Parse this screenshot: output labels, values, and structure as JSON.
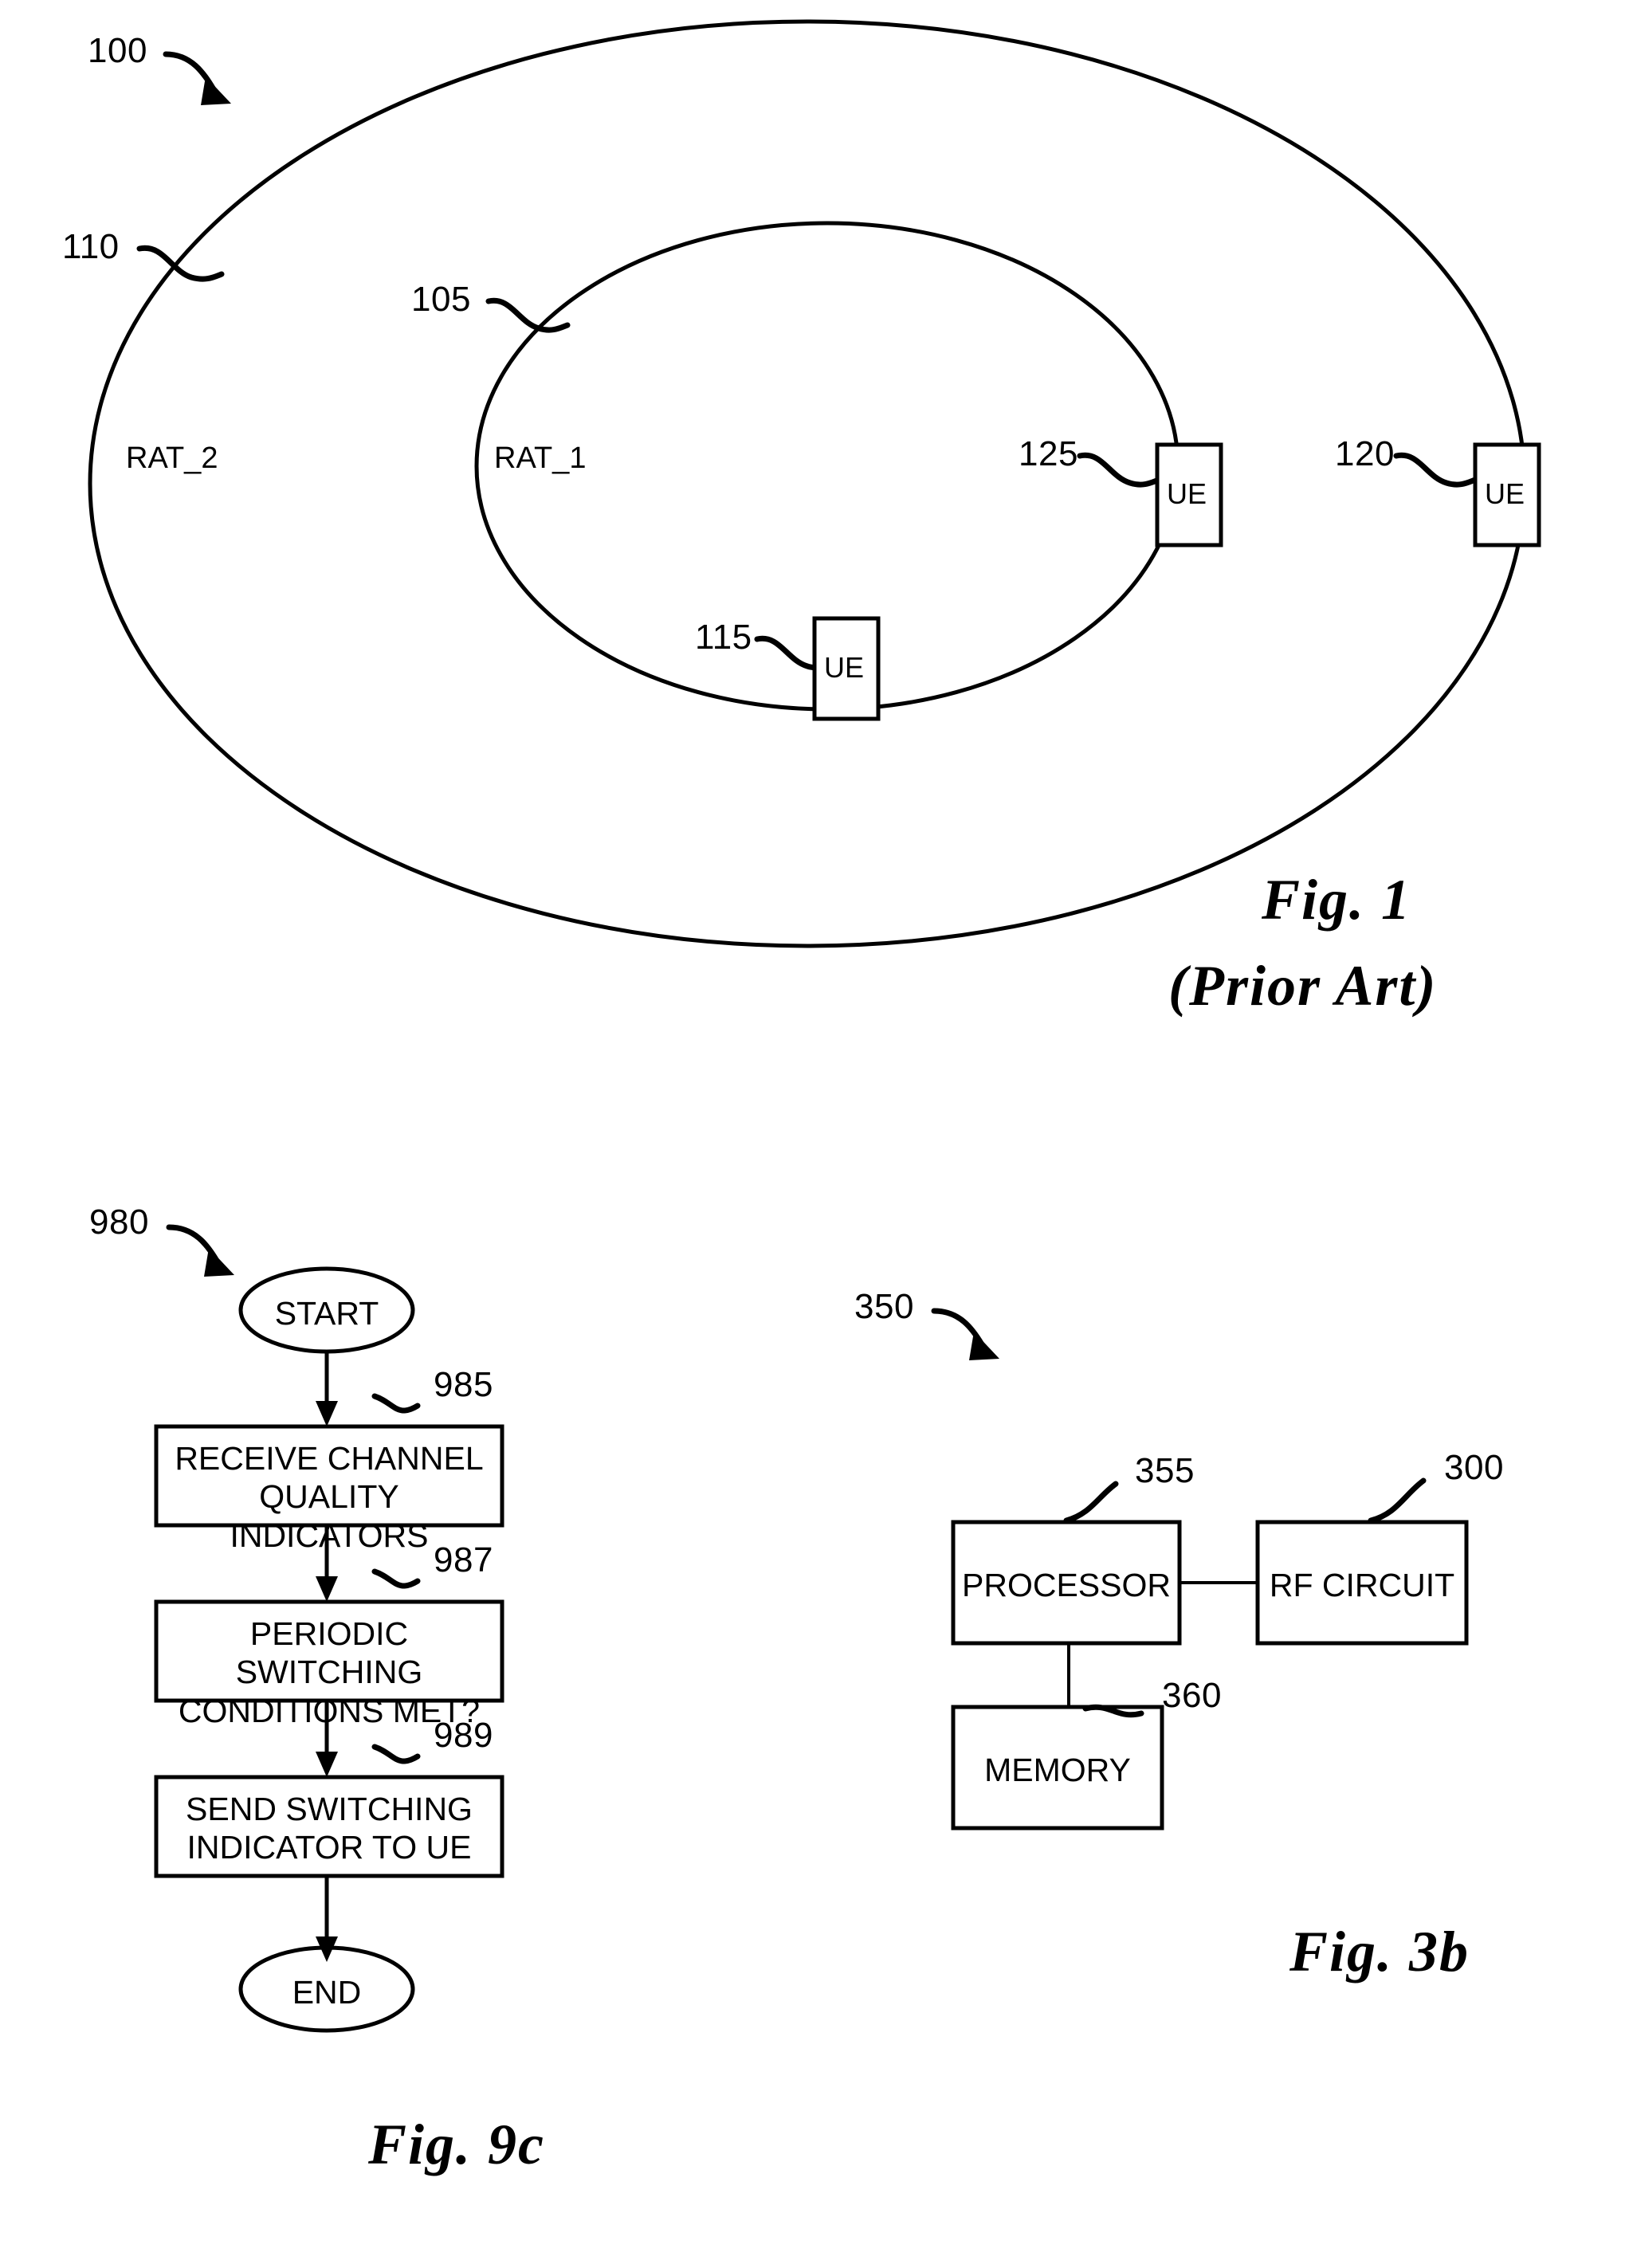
{
  "figure1": {
    "caption_line1": "Fig. 1",
    "caption_line2": "(Prior Art)",
    "ref_system": "100",
    "ref_outer_cell": "110",
    "ref_inner_cell": "105",
    "outer_cell_label": "RAT_2",
    "inner_cell_label": "RAT_1",
    "ue_inner": {
      "ref": "115",
      "label": "UE"
    },
    "ue_boundary": {
      "ref": "125",
      "label": "UE"
    },
    "ue_outer": {
      "ref": "120",
      "label": "UE"
    }
  },
  "figure9c": {
    "caption": "Fig. 9c",
    "ref_flow": "980",
    "nodes": [
      {
        "ref": "",
        "label": "START",
        "shape": "terminal"
      },
      {
        "ref": "985",
        "label": "RECEIVE CHANNEL\nQUALITY INDICATORS",
        "shape": "process"
      },
      {
        "ref": "987",
        "label": "PERIODIC SWITCHING\nCONDITIONS MET?",
        "shape": "process"
      },
      {
        "ref": "989",
        "label": "SEND SWITCHING\nINDICATOR TO UE",
        "shape": "process"
      },
      {
        "ref": "",
        "label": "END",
        "shape": "terminal"
      }
    ]
  },
  "figure3b": {
    "caption": "Fig. 3b",
    "ref_device": "350",
    "blocks": [
      {
        "ref": "355",
        "label": "PROCESSOR"
      },
      {
        "ref": "300",
        "label": "RF CIRCUIT"
      },
      {
        "ref": "360",
        "label": "MEMORY"
      }
    ]
  },
  "colors": {
    "ink": "#000000",
    "paper": "#ffffff"
  }
}
